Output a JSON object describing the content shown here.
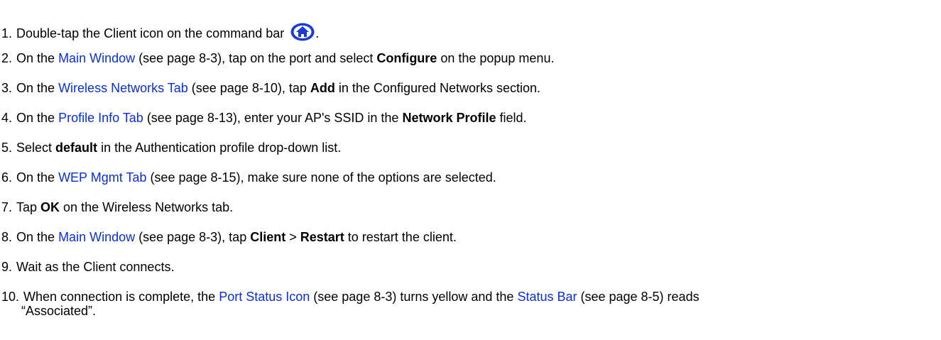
{
  "steps": [
    {
      "num": "1.",
      "parts": [
        "Double-tap the Client icon on the command bar",
        "."
      ],
      "icon": "client-icon"
    },
    {
      "num": "2.",
      "pre": "On the ",
      "link": "Main Window",
      "mid": " (see page 8-3), tap on the port and select ",
      "bold": "Configure",
      "post": " on the popup menu."
    },
    {
      "num": "3.",
      "pre": "On the ",
      "link": "Wireless Networks Tab",
      "mid": " (see page 8-10), tap ",
      "bold": "Add",
      "post": " in the Configured Networks section."
    },
    {
      "num": "4.",
      "pre": "On the ",
      "link": "Profile Info Tab",
      "mid": " (see page 8-13), enter your AP's SSID in the ",
      "bold": "Network Profile",
      "post": " field."
    },
    {
      "num": "5.",
      "pre": "Select ",
      "bold": "default",
      "post": " in the Authentication profile drop-down list."
    },
    {
      "num": "6.",
      "pre": "On the ",
      "link": "WEP Mgmt Tab",
      "post": " (see page 8-15), make sure none of the options are selected."
    },
    {
      "num": "7.",
      "pre": "Tap ",
      "bold": "OK",
      "post": " on the Wireless Networks tab."
    },
    {
      "num": "8.",
      "pre": "On the ",
      "link": "Main Window",
      "mid": " (see page 8-3), tap ",
      "bold": "Client",
      "mid2": " > ",
      "bold2": "Restart",
      "post": " to restart the client."
    },
    {
      "num": "9.",
      "text": "Wait as the Client connects."
    },
    {
      "num": "10.",
      "pre": "When connection is complete, the ",
      "link": "Port Status Icon",
      "mid": " (see page 8-3) turns yellow and the ",
      "link2": "Status Bar",
      "post": " (see page 8-5) reads",
      "cont": "“Associated”."
    }
  ],
  "colors": {
    "link": "#0b2fd8",
    "icon": "#1a3bd6"
  }
}
